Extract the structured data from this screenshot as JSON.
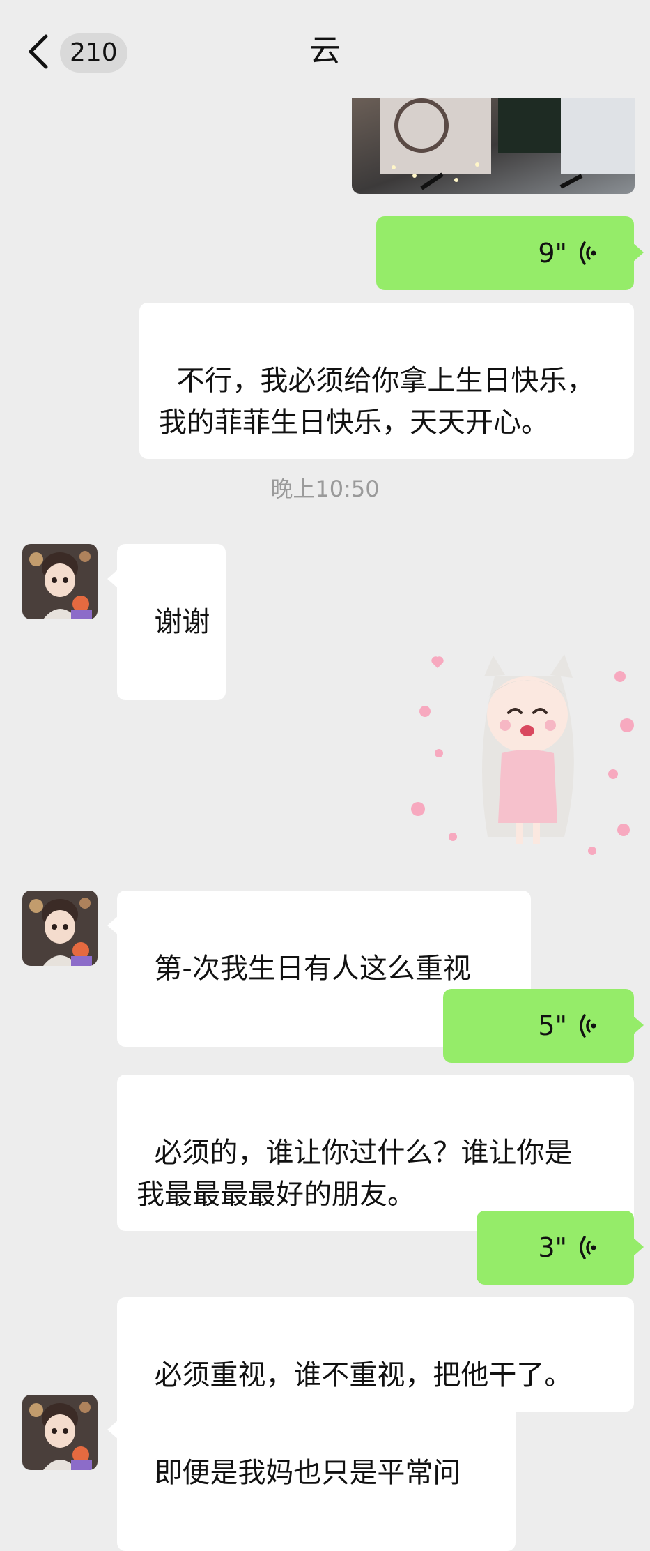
{
  "header": {
    "back_count": "210",
    "title": "云"
  },
  "timestamp": "晚上10:50",
  "messages": [
    {
      "from": "me",
      "type": "image"
    },
    {
      "from": "me",
      "type": "voice",
      "duration": "9\""
    },
    {
      "from": "me",
      "type": "text",
      "text": "不行，我必须给你拿上生日快乐，\n我的菲菲生日快乐，天天开心。"
    },
    {
      "from": "other",
      "type": "text",
      "text": "谢谢"
    },
    {
      "from": "me",
      "type": "sticker"
    },
    {
      "from": "other",
      "type": "text",
      "text": "第-次我生日有人这么重视"
    },
    {
      "from": "me",
      "type": "voice",
      "duration": "5\""
    },
    {
      "from": "me",
      "type": "text",
      "text": "必须的，谁让你过什么？谁让你是\n我最最最最好的朋友。"
    },
    {
      "from": "me",
      "type": "voice",
      "duration": "3\""
    },
    {
      "from": "me",
      "type": "text",
      "text": "必须重视，谁不重视，把他干了。"
    },
    {
      "from": "other",
      "type": "text",
      "text": "即便是我妈也只是平常问"
    }
  ],
  "colors": {
    "background": "#ededed",
    "my_bubble": "#95ec69",
    "their_bubble": "#ffffff",
    "timestamp": "#9a9a9a"
  },
  "icons": {
    "back": "chevron-left-icon",
    "voice": "voice-wave-icon"
  }
}
